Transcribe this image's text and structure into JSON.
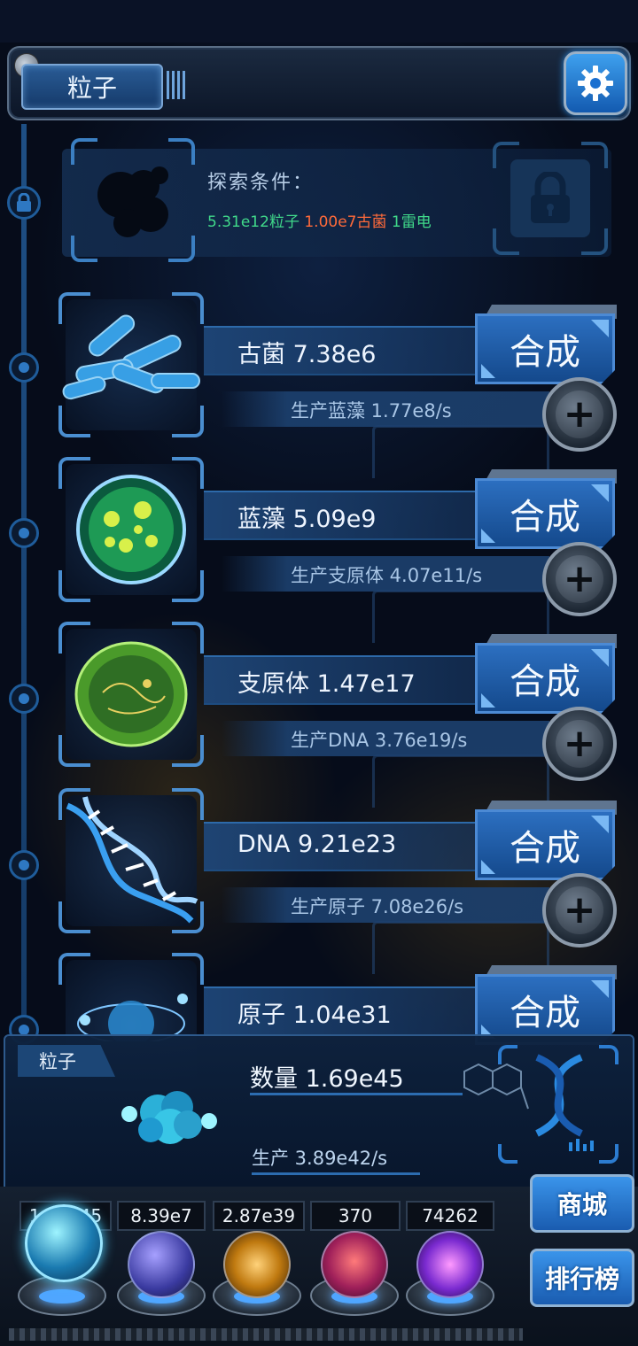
{
  "header": {
    "title": "粒子",
    "settings_icon": "gear-icon"
  },
  "explore": {
    "label": "探索条件：",
    "conditions": [
      {
        "text": "5.31e12粒子",
        "color": "#40d98a"
      },
      {
        "text": "1.00e7古菌",
        "color": "#ff6a3a"
      },
      {
        "text": "1雷电",
        "color": "#40d98a"
      }
    ],
    "locked_icon": "lock-icon"
  },
  "items": [
    {
      "name": "古菌 7.38e6",
      "production": "生产蓝藻 1.77e8/s",
      "synth_label": "合成",
      "icon": "archaea-icon"
    },
    {
      "name": "蓝藻 5.09e9",
      "production": "生产支原体 4.07e11/s",
      "synth_label": "合成",
      "icon": "cyanobacteria-icon"
    },
    {
      "name": "支原体 1.47e17",
      "production": "生产DNA 3.76e19/s",
      "synth_label": "合成",
      "icon": "mycoplasma-icon"
    },
    {
      "name": "DNA 9.21e23",
      "production": "生产原子 7.08e26/s",
      "synth_label": "合成",
      "icon": "dna-icon"
    },
    {
      "name": "原子 1.04e31",
      "production": "",
      "synth_label": "合成",
      "icon": "atom-icon"
    }
  ],
  "summary": {
    "tag": "粒子",
    "count": "数量 1.69e45",
    "production": "生产 3.89e42/s"
  },
  "resources": [
    {
      "value": "1.69e45",
      "orb": "particle-orb-icon"
    },
    {
      "value": "8.39e7",
      "orb": "lightning-orb-icon"
    },
    {
      "value": "2.87e39",
      "orb": "galaxy-orb-icon"
    },
    {
      "value": "370",
      "orb": "brain-orb-icon"
    },
    {
      "value": "74262",
      "orb": "portal-orb-icon"
    }
  ],
  "side_buttons": {
    "shop": "商城",
    "ranking": "排行榜"
  },
  "colors": {
    "accent": "#2c6fc0",
    "condition_met": "#40d98a",
    "condition_unmet": "#ff6a3a"
  }
}
